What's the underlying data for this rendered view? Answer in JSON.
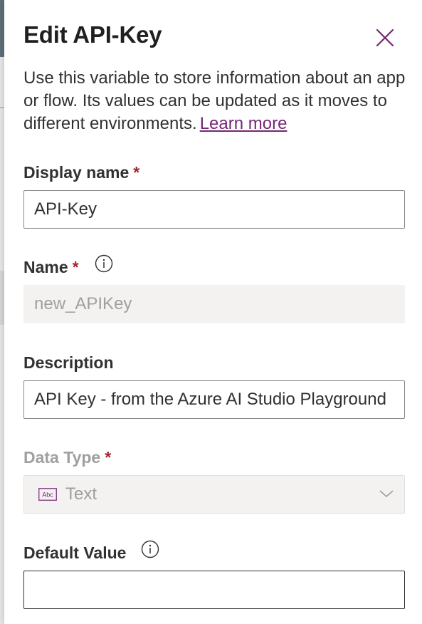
{
  "dialog": {
    "title": "Edit API-Key",
    "close_icon": "close-icon",
    "description": "Use this variable to store information about an app or flow. Its values can be updated as it moves to different environments.",
    "learn_more": "Learn more"
  },
  "fields": {
    "display_name": {
      "label": "Display name",
      "required": "*",
      "value": "API-Key"
    },
    "name": {
      "label": "Name",
      "required": "*",
      "value": "new_APIKey",
      "info_icon": "info-icon"
    },
    "description": {
      "label": "Description",
      "value": "API Key - from the Azure AI Studio Playground"
    },
    "data_type": {
      "label": "Data Type",
      "required": "*",
      "selected": "Text",
      "type_icon": "abc-text-icon",
      "chevron_icon": "chevron-down-icon"
    },
    "default_value": {
      "label": "Default Value",
      "value": "",
      "info_icon": "info-icon"
    }
  },
  "colors": {
    "accent": "#742774",
    "required": "#a4262c",
    "disabled_text": "#a19f9d",
    "disabled_bg": "#f3f2f1"
  }
}
